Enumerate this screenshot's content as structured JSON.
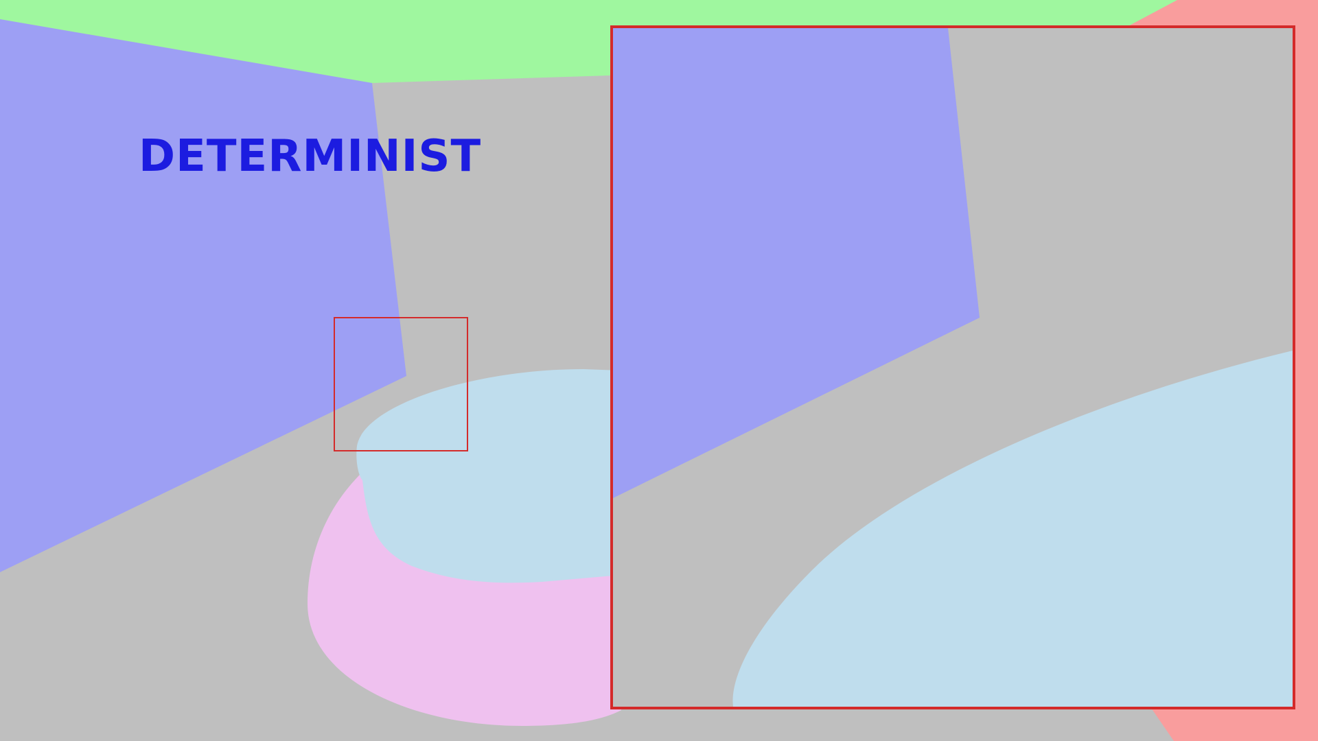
{
  "scene": {
    "label": "DETERMINIST",
    "colors": {
      "floor": "#bfbfbf",
      "green_wall": "#9ff79f",
      "blue_wall": "#9d9ff4",
      "red_wall": "#f99d9d",
      "cylinder_top": "#bfdded",
      "cylinder_side": "#efc1ef",
      "label_text": "#1c1ce0",
      "highlight_box": "#d42a2a"
    }
  }
}
